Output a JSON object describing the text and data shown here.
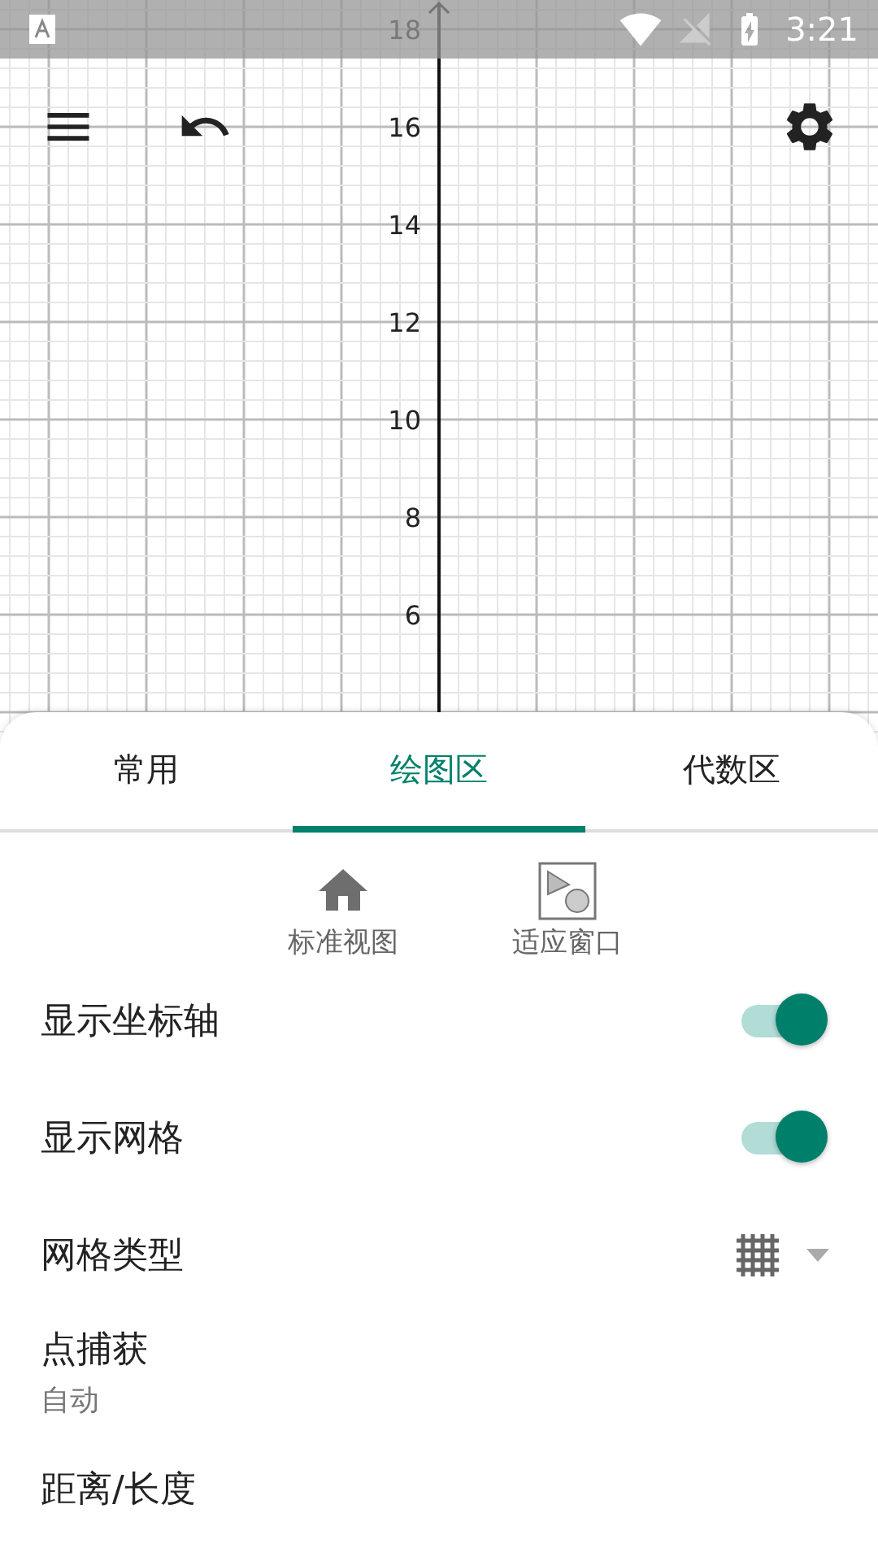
{
  "status_bar": {
    "time": "3:21"
  },
  "graph": {
    "y_labels": [
      "18",
      "16",
      "14",
      "12",
      "10",
      "8",
      "6"
    ]
  },
  "tabs": [
    {
      "label": "常用",
      "selected": false
    },
    {
      "label": "绘图区",
      "selected": true
    },
    {
      "label": "代数区",
      "selected": false
    }
  ],
  "view_buttons": [
    {
      "label": "标准视图",
      "kind": "home"
    },
    {
      "label": "适应窗口",
      "kind": "fit"
    }
  ],
  "settings": [
    {
      "kind": "switch",
      "label": "显示坐标轴",
      "on": true
    },
    {
      "kind": "switch",
      "label": "显示网格",
      "on": true
    },
    {
      "kind": "dropdown",
      "label": "网格类型"
    },
    {
      "kind": "value",
      "label": "点捕获",
      "value": "自动"
    },
    {
      "kind": "value",
      "label": "距离/长度"
    }
  ]
}
